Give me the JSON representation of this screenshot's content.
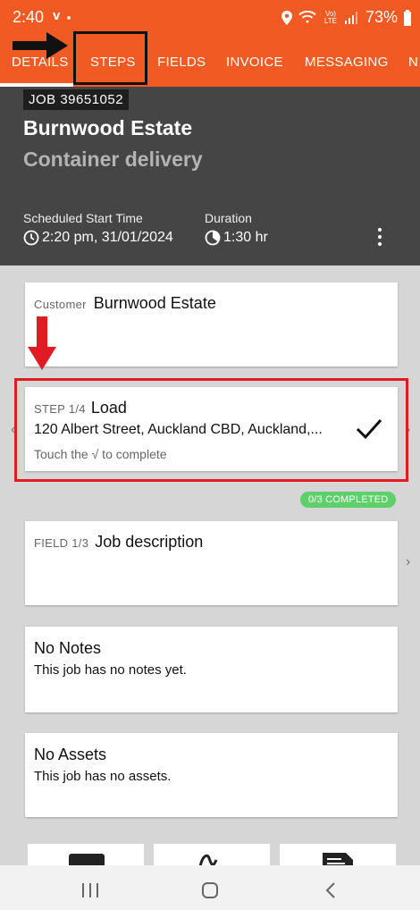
{
  "status_bar": {
    "time": "2:40",
    "carrier_symbol": "v",
    "battery": "73%",
    "lte_top": "Vo)",
    "lte_bottom": "LTE"
  },
  "tabs": [
    "DETAILS",
    "STEPS",
    "FIELDS",
    "INVOICE",
    "MESSAGING",
    "N"
  ],
  "active_tab": "DETAILS",
  "header": {
    "job_badge": "JOB 39651052",
    "client_name": "Burnwood Estate",
    "job_type": "Container delivery",
    "scheduled_label": "Scheduled Start Time",
    "scheduled_value": "2:20 pm, 31/01/2024",
    "duration_label": "Duration",
    "duration_value": "1:30 hr"
  },
  "customer_card": {
    "label": "Customer",
    "value": "Burnwood Estate"
  },
  "step_card": {
    "label": "STEP 1/4",
    "title": "Load",
    "address": "120 Albert Street, Auckland CBD, Auckland,...",
    "hint": "Touch the √ to complete"
  },
  "completed_badge": "0/3 COMPLETED",
  "field_card": {
    "label": "FIELD 1/3",
    "title": "Job description"
  },
  "notes_card": {
    "title": "No Notes",
    "description": "This job has no notes yet."
  },
  "assets_card": {
    "title": "No Assets",
    "description": "This job has no assets."
  },
  "colors": {
    "brand_orange": "#f15a22",
    "header_dark": "#454545",
    "annotation_red": "#e01b24",
    "completed_green": "#5fcf6b"
  }
}
